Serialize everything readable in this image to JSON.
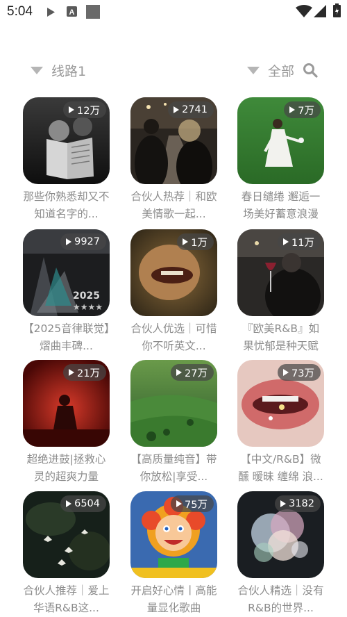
{
  "status_bar": {
    "time": "5:04",
    "icons": [
      "play-icon",
      "a-box-icon",
      "square-icon",
      "wifi-icon",
      "signal-icon",
      "battery-charging-icon"
    ]
  },
  "filter_bar": {
    "route_label": "线路1",
    "category_label": "全部",
    "icons": [
      "dropdown-triangle-icon",
      "search-icon"
    ]
  },
  "playlists": [
    {
      "count": "12万",
      "title": "那些你熟悉却又不知道名字的..."
    },
    {
      "count": "2741",
      "title": "合伙人热荐｜和欧美情歌一起..."
    },
    {
      "count": "7万",
      "title": "春日缱绻  邂逅一场美好蓄意浪漫"
    },
    {
      "count": "9927",
      "title": "【2025音律联觉】熠曲丰碑..."
    },
    {
      "count": "1万",
      "title": "合伙人优选｜可惜你不听英文..."
    },
    {
      "count": "11万",
      "title": "『欧美R&B』如果忧郁是种天赋"
    },
    {
      "count": "21万",
      "title": "超绝进鼓|拯救心灵的超爽力量"
    },
    {
      "count": "27万",
      "title": "【高质量纯音】带你放松|享受..."
    },
    {
      "count": "73万",
      "title": "【中文/R&B】微醺 暧昧 缠绵 浪..."
    },
    {
      "count": "6504",
      "title": "合伙人推荐｜爱上华语R&B这..."
    },
    {
      "count": "75万",
      "title": "开启好心情丨高能量显化歌曲"
    },
    {
      "count": "3182",
      "title": "合伙人精选｜没有R&B的世界..."
    }
  ]
}
